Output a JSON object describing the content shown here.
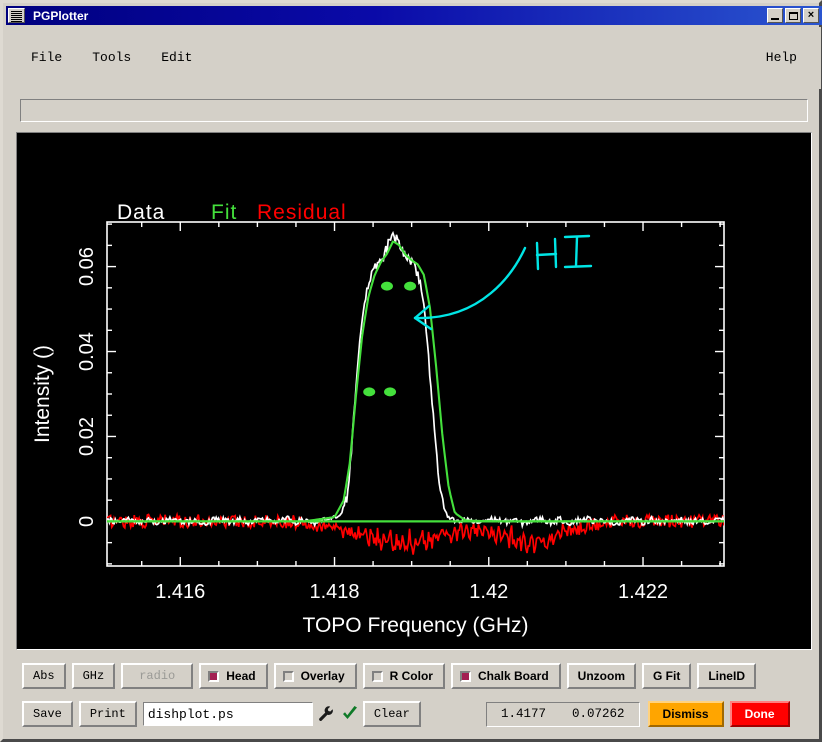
{
  "window": {
    "title": "PGPlotter",
    "buttons": {
      "minimize": "minimize-icon",
      "maximize": "maximize-icon",
      "close": "×"
    }
  },
  "menubar": {
    "items": [
      "File",
      "Tools",
      "Edit"
    ],
    "help": "Help"
  },
  "message_bar": {
    "value": "",
    "placeholder": ""
  },
  "plot": {
    "legend": [
      {
        "label": "Data",
        "color": "#ffffff"
      },
      {
        "label": "Fit",
        "color": "#44e03c"
      },
      {
        "label": "Residual",
        "color": "#ff0000"
      }
    ],
    "annotation": {
      "text": "HI",
      "color": "#00e5e5",
      "kind": "chalk-arrow"
    }
  },
  "chart_data": {
    "type": "line",
    "title": "",
    "xlabel": "TOPO Frequency (GHz)",
    "ylabel": "Intensity ()",
    "xlim": [
      1.41505,
      1.42305
    ],
    "ylim": [
      -0.0105,
      0.0705
    ],
    "xticks": [
      1.416,
      1.418,
      1.42,
      1.422
    ],
    "xtick_labels": [
      "1.416",
      "1.418",
      "1.42",
      "1.422"
    ],
    "yticks": [
      0,
      0.02,
      0.04,
      0.06
    ],
    "ytick_labels": [
      "0",
      "0.02",
      "0.04",
      "0.06"
    ],
    "grid": false,
    "legend_position": "above-axes-left",
    "series": [
      {
        "name": "Data",
        "color": "#ffffff",
        "type": "line",
        "x": [
          1.4151,
          1.41522,
          1.41534,
          1.41546,
          1.41558,
          1.4157,
          1.41582,
          1.41594,
          1.41606,
          1.41618,
          1.4163,
          1.41642,
          1.41654,
          1.41666,
          1.41678,
          1.4169,
          1.41702,
          1.41714,
          1.41726,
          1.41738,
          1.4175,
          1.41762,
          1.41774,
          1.41786,
          1.41798,
          1.4181,
          1.41816,
          1.41822,
          1.41828,
          1.41834,
          1.4184,
          1.41846,
          1.41852,
          1.41858,
          1.41864,
          1.4187,
          1.41876,
          1.41882,
          1.41888,
          1.41894,
          1.419,
          1.41906,
          1.41912,
          1.41918,
          1.41924,
          1.4193,
          1.41936,
          1.41942,
          1.41948,
          1.41954,
          1.4196,
          1.41972,
          1.41984,
          1.41996,
          1.42008,
          1.4202,
          1.42032,
          1.42044,
          1.42056,
          1.42068,
          1.4208,
          1.42092,
          1.42104,
          1.42116,
          1.42128,
          1.4214,
          1.42152,
          1.42164,
          1.42176,
          1.42188,
          1.422,
          1.42212,
          1.42224,
          1.42236,
          1.42248,
          1.4226,
          1.42272,
          1.42284,
          1.42296
        ],
        "y": [
          0.0003,
          -0.0004,
          0.0006,
          -0.0002,
          0.0005,
          -0.0005,
          0.0002,
          0.0007,
          -0.0003,
          0.0004,
          -0.0006,
          0.0003,
          0.0005,
          -0.0002,
          0.0006,
          -0.0004,
          0.0002,
          0.0005,
          -0.0003,
          0.0007,
          -0.0002,
          0.0004,
          -0.0005,
          0.0003,
          0.0006,
          0.002,
          0.006,
          0.0165,
          0.032,
          0.045,
          0.053,
          0.0575,
          0.06,
          0.0615,
          0.0628,
          0.0655,
          0.068,
          0.066,
          0.0635,
          0.062,
          0.0612,
          0.0598,
          0.056,
          0.047,
          0.034,
          0.02,
          0.009,
          0.003,
          0.0008,
          0.0002,
          -0.0003,
          0.0005,
          -0.0004,
          0.0003,
          0.0006,
          -0.0002,
          0.0004,
          -0.0005,
          0.0002,
          0.0006,
          -0.0003,
          0.0005,
          -0.0004,
          0.0003,
          0.0007,
          -0.0002,
          0.0004,
          -0.0006,
          0.0003,
          0.0005,
          -0.0003,
          0.0006,
          -0.0004,
          0.0002,
          0.0005,
          -0.0003,
          0.0004,
          -0.0005,
          0.0003
        ]
      },
      {
        "name": "Fit",
        "color": "#44e03c",
        "type": "line",
        "x": [
          1.4151,
          1.4156,
          1.4161,
          1.4166,
          1.4171,
          1.4176,
          1.418,
          1.41812,
          1.4182,
          1.41828,
          1.41836,
          1.41844,
          1.41852,
          1.4186,
          1.41868,
          1.41876,
          1.41884,
          1.41892,
          1.419,
          1.41908,
          1.41916,
          1.41924,
          1.41932,
          1.4194,
          1.41948,
          1.41956,
          1.4197,
          1.4201,
          1.4206,
          1.4211,
          1.4216,
          1.4221,
          1.4226,
          1.42296
        ],
        "y": [
          0.0,
          0.0,
          0.0,
          0.0,
          0.0,
          0.0,
          0.001,
          0.005,
          0.014,
          0.03,
          0.044,
          0.053,
          0.058,
          0.061,
          0.063,
          0.066,
          0.065,
          0.0628,
          0.0615,
          0.0605,
          0.058,
          0.05,
          0.036,
          0.02,
          0.008,
          0.002,
          0.0002,
          0.0,
          0.0,
          0.0,
          0.0,
          0.0,
          0.0,
          0.0
        ]
      },
      {
        "name": "Residual",
        "color": "#ff0000",
        "type": "line",
        "noise_amplitude": 0.0016,
        "baseline": 0.0,
        "features": [
          {
            "center": 1.4189,
            "width": 0.00075,
            "depth": -0.0065,
            "note": "fit-residual-ripple"
          },
          {
            "center": 1.42055,
            "width": 0.00055,
            "depth": -0.006,
            "note": "absorption-dip"
          }
        ]
      }
    ],
    "markers": [
      {
        "x": 1.41868,
        "y": 0.0554,
        "color": "#44e03c",
        "note": "peak-marker-left"
      },
      {
        "x": 1.41898,
        "y": 0.0554,
        "color": "#44e03c",
        "note": "peak-marker-right"
      },
      {
        "x": 1.41845,
        "y": 0.0305,
        "color": "#44e03c",
        "note": "halfmax-marker-left"
      },
      {
        "x": 1.41872,
        "y": 0.0305,
        "color": "#44e03c",
        "note": "halfmax-marker-right"
      }
    ]
  },
  "controls": {
    "row1": [
      {
        "id": "abs",
        "label": "Abs",
        "kind": "button",
        "state": "enabled"
      },
      {
        "id": "ghz",
        "label": "GHz",
        "kind": "button",
        "state": "enabled"
      },
      {
        "id": "radio",
        "label": "radio",
        "kind": "button",
        "state": "disabled"
      },
      {
        "id": "head",
        "label": "Head",
        "kind": "checkbox",
        "checked": true
      },
      {
        "id": "overlay",
        "label": "Overlay",
        "kind": "checkbox",
        "checked": false
      },
      {
        "id": "rcolor",
        "label": "R Color",
        "kind": "checkbox",
        "checked": false
      },
      {
        "id": "chalkboard",
        "label": "Chalk Board",
        "kind": "checkbox",
        "checked": true
      },
      {
        "id": "unzoom",
        "label": "Unzoom",
        "kind": "button",
        "state": "enabled"
      },
      {
        "id": "gfit",
        "label": "G Fit",
        "kind": "button",
        "state": "enabled"
      },
      {
        "id": "lineid",
        "label": "LineID",
        "kind": "button",
        "state": "enabled"
      }
    ],
    "row2": {
      "save": "Save",
      "print": "Print",
      "filename_value": "dishplot.ps",
      "filename_placeholder": "",
      "wrench_icon": "wrench-icon",
      "check_icon": "checkmark-icon",
      "clear": "Clear",
      "coord_x": "1.4177",
      "coord_y": "0.07262",
      "dismiss": "Dismiss",
      "done": "Done"
    }
  },
  "colors": {
    "window_bg": "#d4d0c8",
    "titlebar": "#00007f",
    "plot_bg": "#000000",
    "data": "#ffffff",
    "fit": "#44e03c",
    "residual": "#ff0000",
    "annotation": "#00e5e5",
    "checkbox_on": "#a31f52",
    "dismiss_bg": "#ffa500",
    "done_bg": "#ff0000"
  }
}
